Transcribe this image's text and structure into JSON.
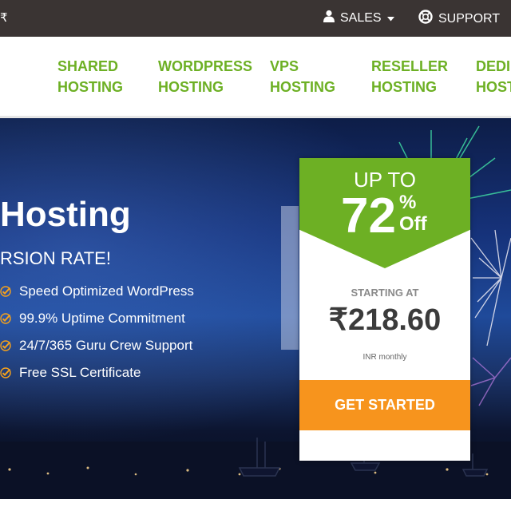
{
  "topbar": {
    "currency": "₹",
    "sales_label": "SALES",
    "support_label": "SUPPORT"
  },
  "nav": {
    "items": [
      {
        "label": "SHARED HOSTING"
      },
      {
        "label": "WORDPRESS HOSTING"
      },
      {
        "label": "VPS HOSTING"
      },
      {
        "label": "RESELLER HOSTING"
      },
      {
        "label": "DEDI HOST"
      }
    ]
  },
  "hero": {
    "title": "Hosting",
    "subtitle": "RSION RATE!",
    "features": [
      "Speed Optimized WordPress",
      "99.9% Uptime Commitment",
      "24/7/365 Guru Crew Support",
      "Free SSL Certificate"
    ]
  },
  "offer": {
    "up_to": "UP TO",
    "percent": "72",
    "percent_symbol": "%",
    "off": "Off",
    "starting_at": "STARTING AT",
    "price": "₹218.60",
    "period": "INR monthly",
    "cta": "GET STARTED"
  },
  "colors": {
    "brand_green": "#6db024",
    "cta_orange": "#f7941d",
    "topbar_bg": "#3a3433",
    "check_orange": "#f7a21b"
  }
}
